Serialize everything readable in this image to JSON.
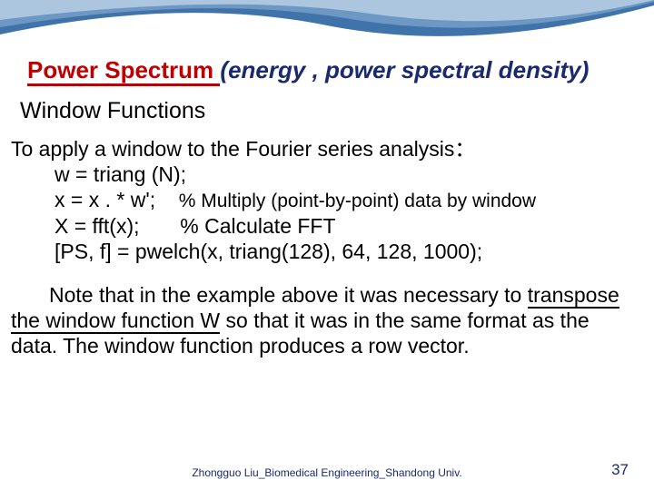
{
  "title": {
    "word1": "Power Spectrum ",
    "paren_open": "(",
    "ital": "energy , power spectral density",
    "paren_close": ")"
  },
  "subtitle": "Window Functions",
  "body": {
    "line1": "To apply a window to the Fourier series analysis：",
    "line2": "w = triang (N);",
    "line3a": "x = x . * w';",
    "line3b": "% Multiply (point-by-point) data by window",
    "line4a": "X = fft(x);",
    "line4b": "% Calculate FFT",
    "line5": "[PS, f] = pwelch(x, triang(128), 64, 128, 1000);",
    "note1a": "Note that in the example above it was necessary to ",
    "note1b": "transpose the window function W",
    "note1c": " so that it was in the same format as the data. The window function produces a row vector."
  },
  "footer": "Zhongguo Liu_Biomedical Engineering_Shandong Univ.",
  "pagenum": "37"
}
